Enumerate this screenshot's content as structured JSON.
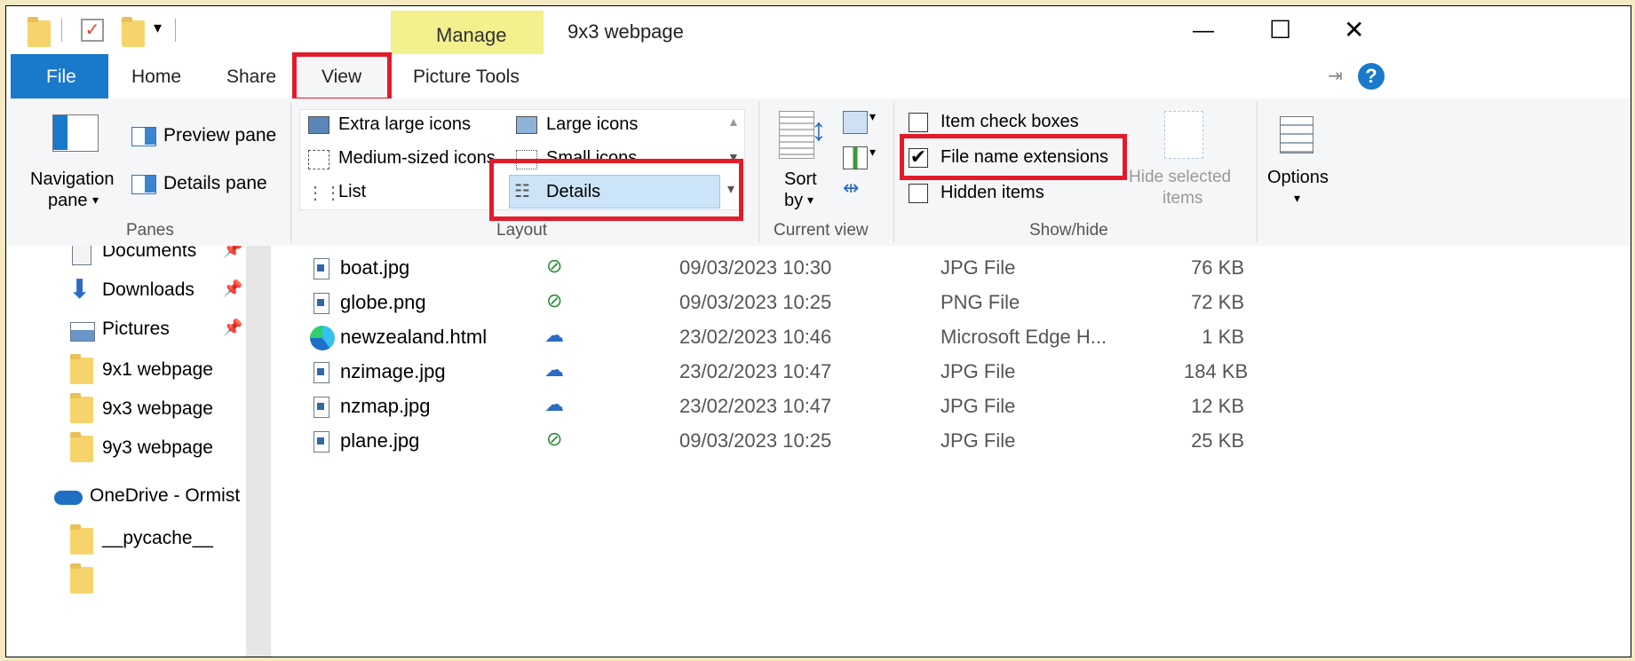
{
  "window": {
    "title": "9x3 webpage",
    "contextual_tab": "Manage",
    "controls": {
      "minimize": "—",
      "maximize": "☐",
      "close": "✕"
    }
  },
  "ribbon_tabs": [
    "File",
    "Home",
    "Share",
    "View",
    "Picture Tools"
  ],
  "active_tab": "View",
  "panes_group": {
    "navigation_pane": "Navigation pane",
    "navigation_pane_line1": "Navigation",
    "navigation_pane_line2": "pane",
    "preview_pane": "Preview pane",
    "details_pane": "Details pane",
    "label": "Panes"
  },
  "layout_group": {
    "items": [
      "Extra large icons",
      "Large icons",
      "Medium-sized icons",
      "Small icons",
      "List",
      "Details"
    ],
    "selected": "Details",
    "label": "Layout"
  },
  "current_view_group": {
    "sort_by_line1": "Sort",
    "sort_by_line2": "by",
    "label": "Current view"
  },
  "show_hide_group": {
    "item_check_boxes": {
      "label": "Item check boxes",
      "checked": false
    },
    "file_name_extensions": {
      "label": "File name extensions",
      "checked": true
    },
    "hidden_items": {
      "label": "Hidden items",
      "checked": false
    },
    "hide_selected_line1": "Hide selected",
    "hide_selected_line2": "items",
    "label": "Show/hide"
  },
  "options_group": {
    "label": "Options"
  },
  "nav_pane": {
    "items": [
      {
        "label": "Documents",
        "icon": "documents-icon"
      },
      {
        "label": "Downloads",
        "icon": "downloads-icon"
      },
      {
        "label": "Pictures",
        "icon": "pictures-icon"
      },
      {
        "label": "9x1 webpage",
        "icon": "folder-icon"
      },
      {
        "label": "9x3 webpage",
        "icon": "folder-icon"
      },
      {
        "label": "9y3 webpage",
        "icon": "folder-icon"
      },
      {
        "label": "OneDrive - Ormist",
        "icon": "onedrive-icon"
      },
      {
        "label": "__pycache__",
        "icon": "folder-icon"
      }
    ]
  },
  "files": [
    {
      "name": "boat.jpg",
      "status": "synced",
      "date": "09/03/2023 10:30",
      "type": "JPG File",
      "size": "76 KB"
    },
    {
      "name": "globe.png",
      "status": "synced",
      "date": "09/03/2023 10:25",
      "type": "PNG File",
      "size": "72 KB"
    },
    {
      "name": "newzealand.html",
      "status": "cloud",
      "date": "23/02/2023 10:46",
      "type": "Microsoft Edge H...",
      "size": "1 KB"
    },
    {
      "name": "nzimage.jpg",
      "status": "cloud",
      "date": "23/02/2023 10:47",
      "type": "JPG File",
      "size": "184 KB"
    },
    {
      "name": "nzmap.jpg",
      "status": "cloud",
      "date": "23/02/2023 10:47",
      "type": "JPG File",
      "size": "12 KB"
    },
    {
      "name": "plane.jpg",
      "status": "synced",
      "date": "09/03/2023 10:25",
      "type": "JPG File",
      "size": "25 KB"
    }
  ],
  "colors": {
    "file_tab": "#1979ca",
    "manage_tab": "#f3f08e",
    "highlight_red": "#e21b2a",
    "synced_green": "#2e8b3a",
    "cloud_blue": "#2a6bc4"
  }
}
